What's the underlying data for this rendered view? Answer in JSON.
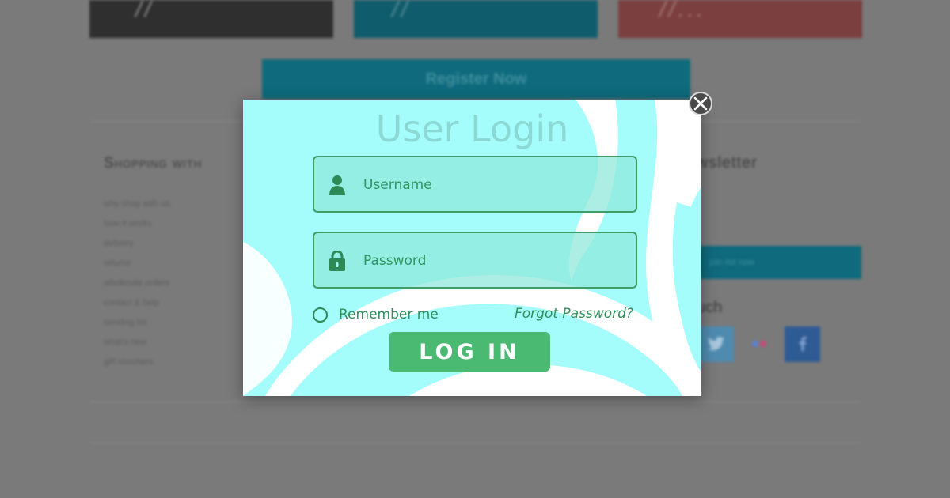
{
  "background": {
    "tiles": [
      {
        "quote": "//"
      },
      {
        "quote": "//"
      },
      {
        "quote": "//..."
      }
    ],
    "register_label": "Register Now",
    "shopping_heading": "Shopping with",
    "shopping_links": [
      "why shop with us",
      "how it works",
      "delivery",
      "returns",
      "wholesale orders",
      "contact & help",
      "sending list",
      "what's new",
      "gift vouchers"
    ],
    "newsletter_heading": "wsletter",
    "newsletter_button": "join list now",
    "touch_heading": "uch",
    "social_icons": [
      "twitter-icon",
      "flickr-icon",
      "social-icon"
    ]
  },
  "modal": {
    "title": "User Login",
    "username_placeholder": "Username",
    "password_placeholder": "Password",
    "remember_label": "Remember me",
    "forgot_label": "Forgot Password?",
    "login_label": "LOG IN",
    "colors": {
      "panel": "#a4fdfb",
      "accent": "#4aba73",
      "text": "#2f8f5c"
    }
  },
  "icons": {
    "username": "user-icon",
    "password": "lock-icon",
    "close": "close-icon"
  }
}
